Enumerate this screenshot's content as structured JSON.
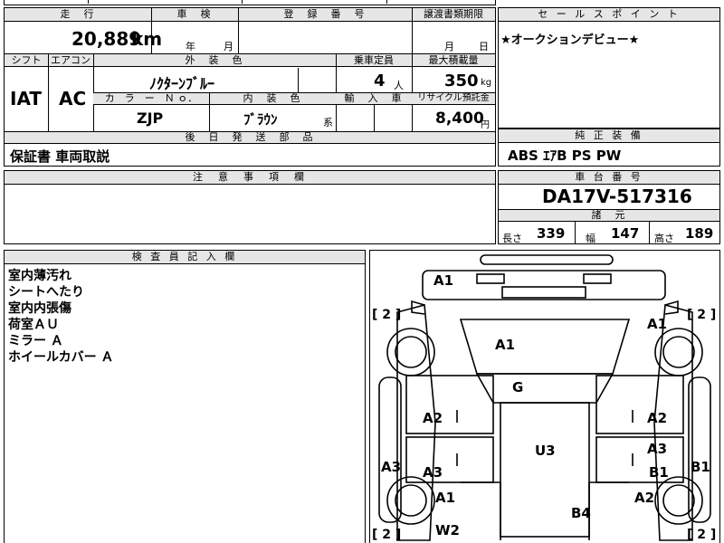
{
  "top_fragment": "",
  "main_table": {
    "headers": {
      "mileage": "走　行",
      "inspection": "車　検",
      "registration": "登　録　番　号",
      "transfer": "譲渡書類期限",
      "shift": "シフト",
      "ac": "エアコン",
      "exterior_color": "外　装　色",
      "capacity": "乗車定員",
      "max_load": "最大積載量",
      "color_no": "カ　ラ　ー　Ｎ ｏ．",
      "interior_color": "内　装　色",
      "import": "輸　入　車",
      "recycle": "リサイクル預託金",
      "delivery_parts": "後　日　発　送　部　品"
    },
    "mileage_value": "20,889",
    "mileage_unit": "km",
    "inspection_year": "年",
    "inspection_month": "月",
    "transfer_month": "月",
    "transfer_day": "日",
    "shift_value": "IAT",
    "ac_value": "AC",
    "exterior_color_value": "ﾉｸﾀｰﾝﾌﾞﾙｰ",
    "capacity_value": "4",
    "capacity_unit": "人",
    "max_load_value": "350",
    "max_load_unit": "kg",
    "color_no_value": "ZJP",
    "interior_color_value": "ﾌﾞﾗｳﾝ",
    "interior_suffix": "系",
    "recycle_value": "8,400",
    "recycle_unit": "円",
    "delivery_parts_value": "保証書 車両取説"
  },
  "sales_point": {
    "header": "セ ー ル ス ポ イ ン ト",
    "text": "★オークションデビュー★"
  },
  "equipment": {
    "header": "純 正 装 備",
    "text": "ABS ｴｱB PS PW"
  },
  "notes": {
    "header": "注　意　事　項　欄",
    "text": ""
  },
  "chassis": {
    "header": "車 台 番 号",
    "value": "DA17V-517316"
  },
  "specs": {
    "header": "諸　元",
    "length_label": "長さ",
    "length_value": "339",
    "width_label": "幅",
    "width_value": "147",
    "height_label": "高さ",
    "height_value": "189"
  },
  "inspector": {
    "header": "検 査 員 記 入 欄",
    "lines": [
      "室内薄汚れ",
      "シートへたり",
      "室内内張傷",
      "荷室ＡＵ",
      "ミラー Ａ",
      "ホイールカバー Ａ"
    ]
  },
  "diagram": {
    "marks": {
      "front_bumper": "A1",
      "hood": "A1",
      "roof_glass": "G",
      "roof": "U3",
      "left_front_door": "A2",
      "left_rear_door": "A3",
      "left_sill": "A3",
      "left_rear_fender": "A1",
      "left_rear_corner": "W2",
      "right_front_fender": "A1",
      "right_front_door": "A2",
      "right_rear_door_1": "A3",
      "right_rear_door_2": "B1",
      "right_sill": "B1",
      "right_rear_fender": "A2",
      "rear_gate": "B4"
    },
    "tires": {
      "front_left": "[ 2 ]",
      "front_right": "[ 2 ]",
      "rear_left": "[ 2 ]",
      "rear_right": "[ 2 ]"
    }
  }
}
